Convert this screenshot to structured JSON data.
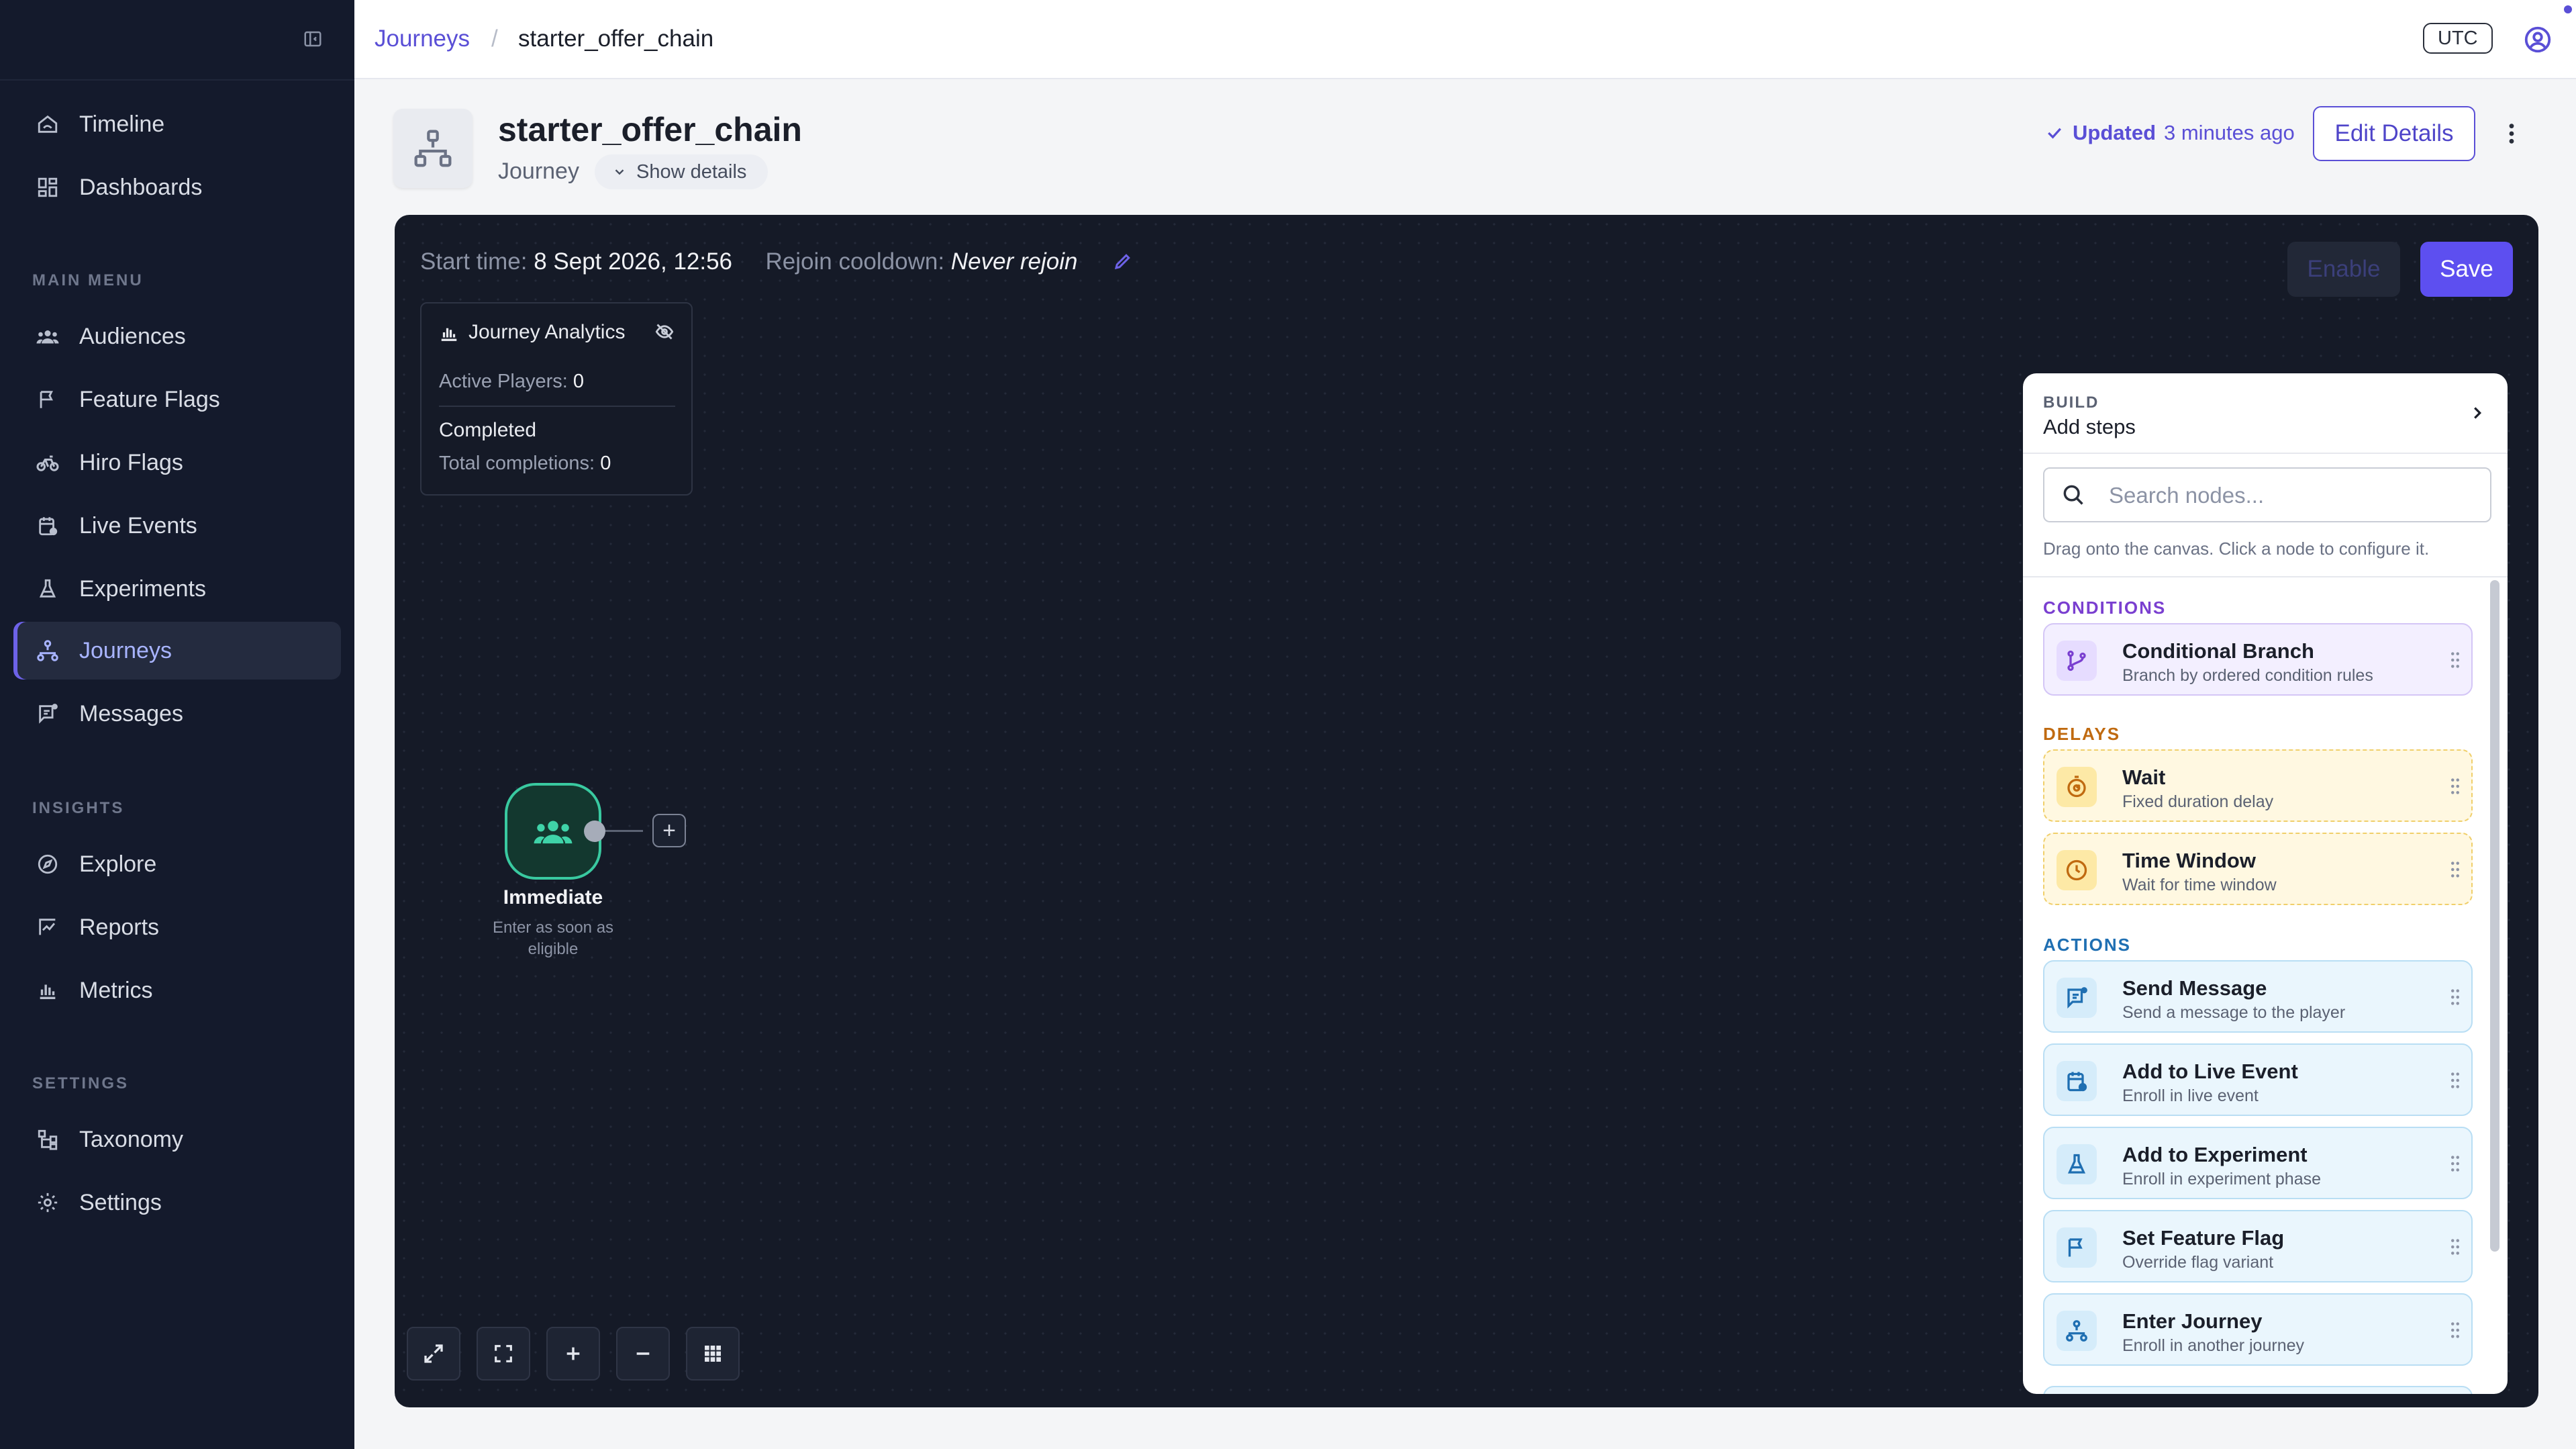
{
  "sidebar": {
    "top_items": [
      {
        "label": "Timeline",
        "icon": "timeline-icon"
      },
      {
        "label": "Dashboards",
        "icon": "dashboard-icon"
      }
    ],
    "sections": {
      "main_menu": "MAIN MENU",
      "insights": "INSIGHTS",
      "settings": "SETTINGS"
    },
    "main_items": [
      {
        "label": "Audiences",
        "icon": "audiences-icon"
      },
      {
        "label": "Feature Flags",
        "icon": "flag-icon"
      },
      {
        "label": "Hiro Flags",
        "icon": "bike-icon"
      },
      {
        "label": "Live Events",
        "icon": "calendar-icon"
      },
      {
        "label": "Experiments",
        "icon": "flask-icon"
      },
      {
        "label": "Journeys",
        "icon": "journey-icon",
        "active": true
      },
      {
        "label": "Messages",
        "icon": "message-icon"
      }
    ],
    "insight_items": [
      {
        "label": "Explore",
        "icon": "compass-icon"
      },
      {
        "label": "Reports",
        "icon": "report-icon"
      },
      {
        "label": "Metrics",
        "icon": "metrics-icon"
      }
    ],
    "setting_items": [
      {
        "label": "Taxonomy",
        "icon": "taxonomy-icon"
      },
      {
        "label": "Settings",
        "icon": "gear-icon"
      }
    ]
  },
  "breadcrumb": {
    "parent": "Journeys",
    "separator": "/",
    "current": "starter_offer_chain"
  },
  "topbar": {
    "timezone": "UTC"
  },
  "journey": {
    "name": "starter_offer_chain",
    "type": "Journey",
    "show_details": "Show details",
    "updated_label": "Updated",
    "updated_time": "3 minutes ago",
    "edit_details": "Edit Details"
  },
  "canvas": {
    "start_label": "Start time:",
    "start_value": "8 Sept 2026, 12:56",
    "cooldown_label": "Rejoin cooldown:",
    "cooldown_value": "Never rejoin",
    "enable": "Enable",
    "save": "Save",
    "analytics": {
      "title": "Journey Analytics",
      "active_label": "Active Players:",
      "active_value": "0",
      "completed": "Completed",
      "total_label": "Total completions:",
      "total_value": "0"
    },
    "start_node": {
      "label": "Immediate",
      "description": "Enter as soon as eligible",
      "add": "+"
    }
  },
  "build_panel": {
    "overline": "BUILD",
    "title": "Add steps",
    "search_placeholder": "Search nodes...",
    "hint": "Drag onto the canvas. Click a node to configure it.",
    "categories": {
      "conditions": "CONDITIONS",
      "delays": "DELAYS",
      "actions": "ACTIONS"
    },
    "conditions": [
      {
        "title": "Conditional Branch",
        "desc": "Branch by ordered condition rules",
        "icon": "branch-icon"
      }
    ],
    "delays": [
      {
        "title": "Wait",
        "desc": "Fixed duration delay",
        "icon": "timer-icon"
      },
      {
        "title": "Time Window",
        "desc": "Wait for time window",
        "icon": "clock-icon"
      }
    ],
    "actions": [
      {
        "title": "Send Message",
        "desc": "Send a message to the player",
        "icon": "message-icon"
      },
      {
        "title": "Add to Live Event",
        "desc": "Enroll in live event",
        "icon": "calendar-icon"
      },
      {
        "title": "Add to Experiment",
        "desc": "Enroll in experiment phase",
        "icon": "flask-icon"
      },
      {
        "title": "Set Feature Flag",
        "desc": "Override flag variant",
        "icon": "flag-icon"
      },
      {
        "title": "Enter Journey",
        "desc": "Enroll in another journey",
        "icon": "journey-icon"
      }
    ]
  },
  "colors": {
    "sidebar_bg": "#141a2c",
    "canvas_bg": "#151a27",
    "accent": "#5d4ff0",
    "start_node": "#39c9a0",
    "condition": "#7a3fd0",
    "delay": "#c06a10",
    "action": "#1f6fb2"
  }
}
